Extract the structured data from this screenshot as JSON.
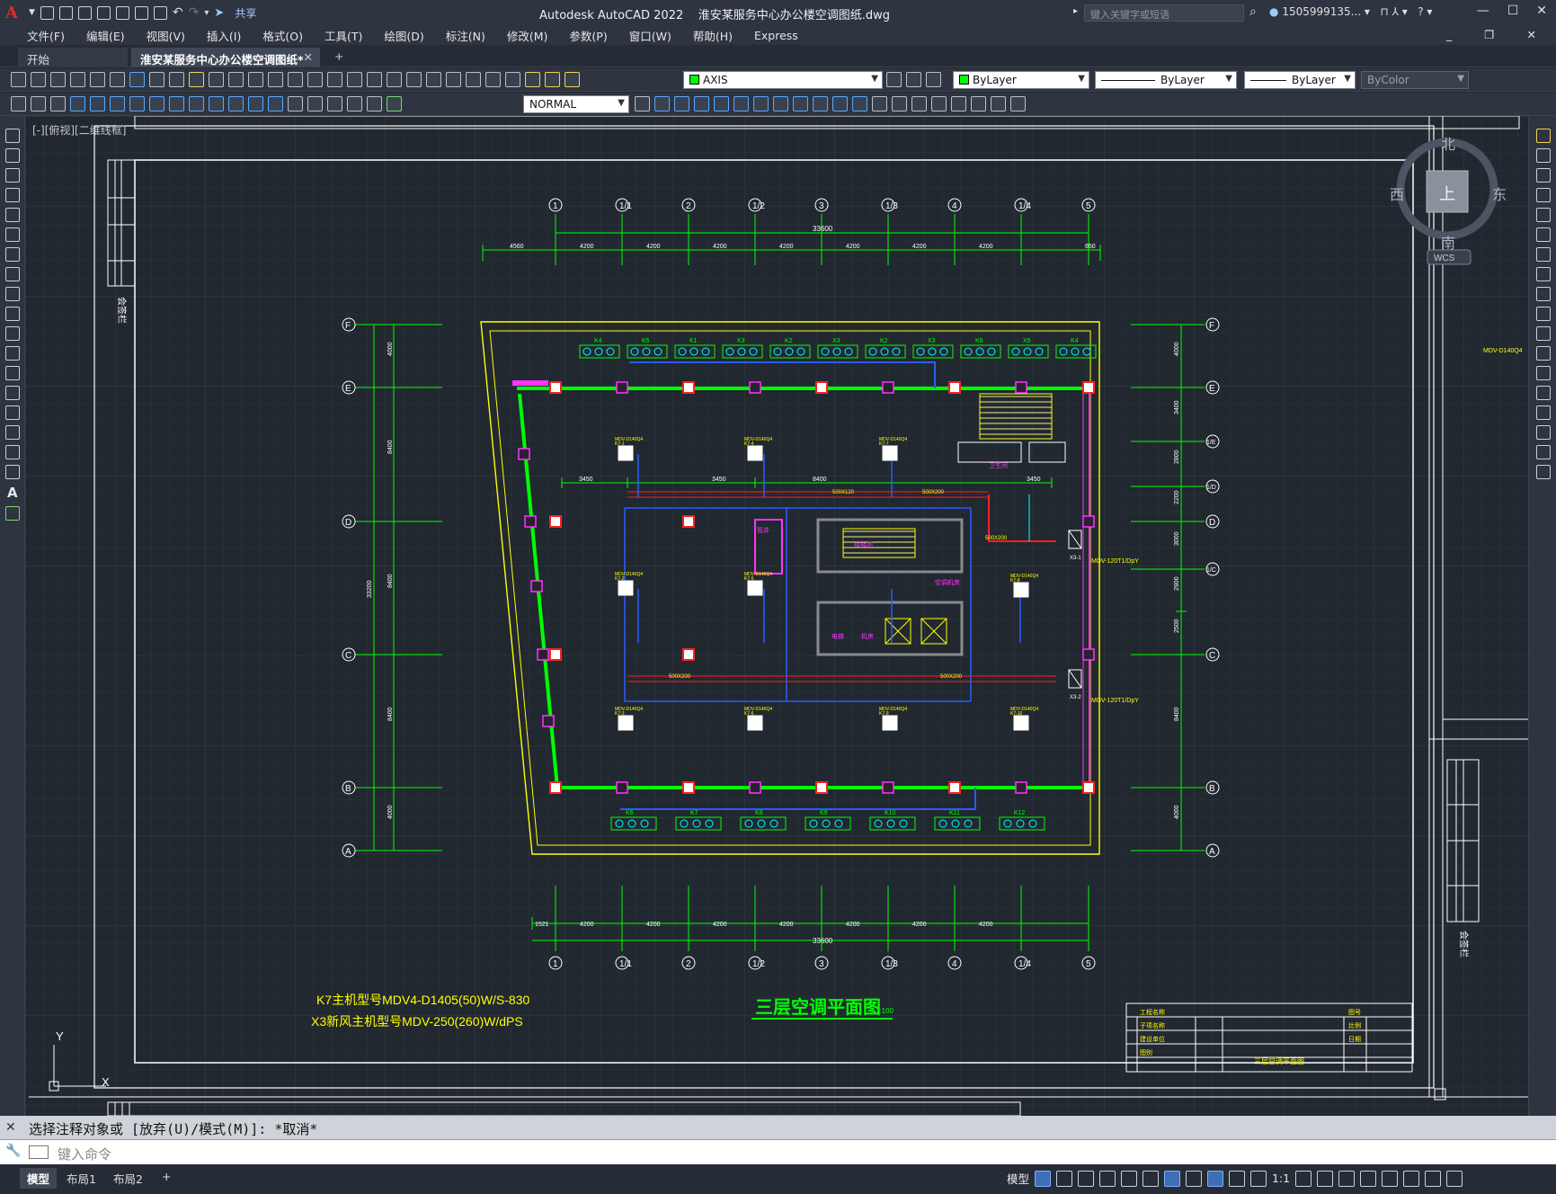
{
  "app": {
    "logo": "A",
    "title": "Autodesk AutoCAD 2022",
    "filename": "淮安某服务中心办公楼空调图纸.dwg",
    "share": "共享",
    "search_placeholder": "键入关键字或短语",
    "user": "1505999135...",
    "help": "?"
  },
  "menus": [
    "文件(F)",
    "编辑(E)",
    "视图(V)",
    "插入(I)",
    "格式(O)",
    "工具(T)",
    "绘图(D)",
    "标注(N)",
    "修改(M)",
    "参数(P)",
    "窗口(W)",
    "帮助(H)",
    "Express"
  ],
  "tabs": {
    "start": "开始",
    "doc": "淮安某服务中心办公楼空调图纸*",
    "close": "✕",
    "add": "+"
  },
  "toolbar": {
    "layer": "AXIS",
    "color": "ByLayer",
    "linetype": "ByLayer",
    "lineweight": "ByLayer",
    "plotstyle": "ByColor",
    "dimstyle": "NORMAL"
  },
  "viewport": {
    "label": "[-][俯视][二维线框]"
  },
  "viewcube": {
    "north": "北",
    "south": "南",
    "east": "东",
    "west": "西",
    "top": "上",
    "wcs": "WCS"
  },
  "command": {
    "history": "选择注释对象或 [放弃(U)/模式(M)]: *取消*",
    "placeholder": "键入命令"
  },
  "layout_tabs": [
    "模型",
    "布局1",
    "布局2",
    "+"
  ],
  "status": {
    "model": "模型",
    "scale": "1:1"
  },
  "drawing": {
    "grid_top": [
      "1",
      "1/1",
      "2",
      "1/2",
      "3",
      "1/3",
      "4",
      "1/4",
      "5"
    ],
    "grid_side": [
      "F",
      "E",
      "D",
      "C",
      "B",
      "A"
    ],
    "grid_right_extra": [
      "1/E",
      "1/D",
      "1/C"
    ],
    "dims_top": [
      "4560",
      "4200",
      "4200",
      "4200",
      "4200",
      "4200",
      "4200",
      "4200",
      "650"
    ],
    "dim_top_total": "33600",
    "dims_bottom": [
      "1521",
      "4200",
      "4200",
      "4200",
      "4200",
      "4200",
      "4200",
      "4200"
    ],
    "dim_bottom_total": "33600",
    "dims_left": [
      "4000",
      "8400",
      "8400",
      "8400",
      "4000"
    ],
    "dim_left_total": "33200",
    "dims_right": [
      "4000",
      "3400",
      "2800",
      "2200",
      "3000",
      "2900",
      "2500",
      "8400",
      "4000"
    ],
    "dims_inner": [
      "3450",
      "3450",
      "8400",
      "3450"
    ],
    "top_units": [
      "K4",
      "K5",
      "K1",
      "K3",
      "K2",
      "X3",
      "K2",
      "X3",
      "K6",
      "X5",
      "K4"
    ],
    "bottom_units": [
      "K6",
      "K7",
      "K8",
      "K9",
      "K10",
      "K11",
      "K12"
    ],
    "indoor_unit": "MDV-D140Q4",
    "indoor_codes": [
      "K7-1",
      "K7-4",
      "K7-7",
      "K7-2",
      "K7-5",
      "K7-8",
      "K7-3",
      "K7-6",
      "K7-9",
      "K7-10"
    ],
    "fresh_air": [
      "MDV-120T1/DpY",
      "MDV-120T1/DpY"
    ],
    "fa_units": [
      "X3-1",
      "X3-2"
    ],
    "duct_labels": [
      "500X120",
      "500X200",
      "500X200",
      "500X200",
      "500X200"
    ],
    "room_labels": [
      "楼梯间",
      "电梯",
      "管井",
      "卫生间",
      "空调机房",
      "机房"
    ],
    "note1": "K7主机型号MDV4-D1405(50)W/S-830",
    "note2": "X3新风主机型号MDV-250(260)W/dPS",
    "title": "三层空调平面图",
    "scale": "1:100",
    "title_block": [
      "工程名称",
      "子项名称",
      "建设单位",
      "图别",
      "图号",
      "比例",
      "日期"
    ],
    "title_block_sheet": "三层空调平面图",
    "side_label": "会签栏",
    "right_code": "MDV-D140Q4"
  }
}
